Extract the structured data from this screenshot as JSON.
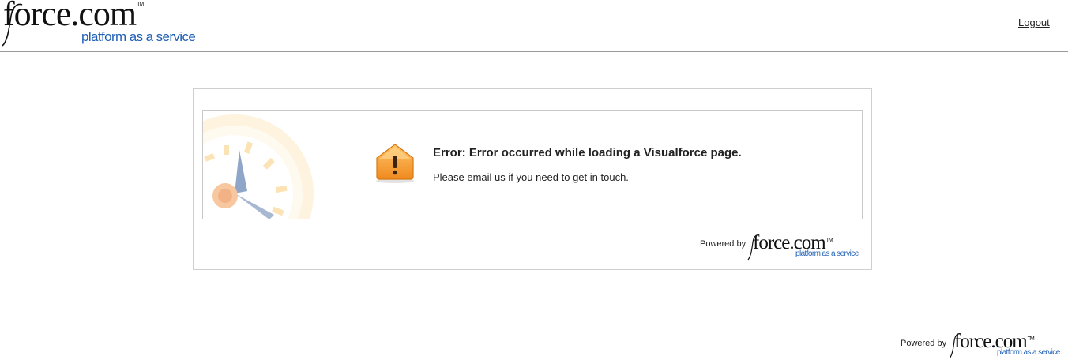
{
  "header": {
    "logo": {
      "wordmark": "force.com",
      "trademark": "TM",
      "tagline": "platform as a service"
    },
    "logout_label": "Logout"
  },
  "error_panel": {
    "icon": "warning-icon",
    "title": "Error: Error occurred while loading a Visualforce page.",
    "message_prefix": "Please ",
    "link_label": "email us",
    "message_suffix": " if you need to get in touch.",
    "powered_by_label": "Powered by",
    "logo": {
      "wordmark": "force.com",
      "trademark": "TM",
      "tagline": "platform as a service"
    }
  },
  "footer": {
    "powered_by_label": "Powered by",
    "logo": {
      "wordmark": "force.com",
      "trademark": "TM",
      "tagline": "platform as a service"
    }
  },
  "colors": {
    "tagline_blue": "#1f5fb5",
    "warning_orange": "#f39a2c",
    "divider_gray": "#9a9a9a"
  }
}
